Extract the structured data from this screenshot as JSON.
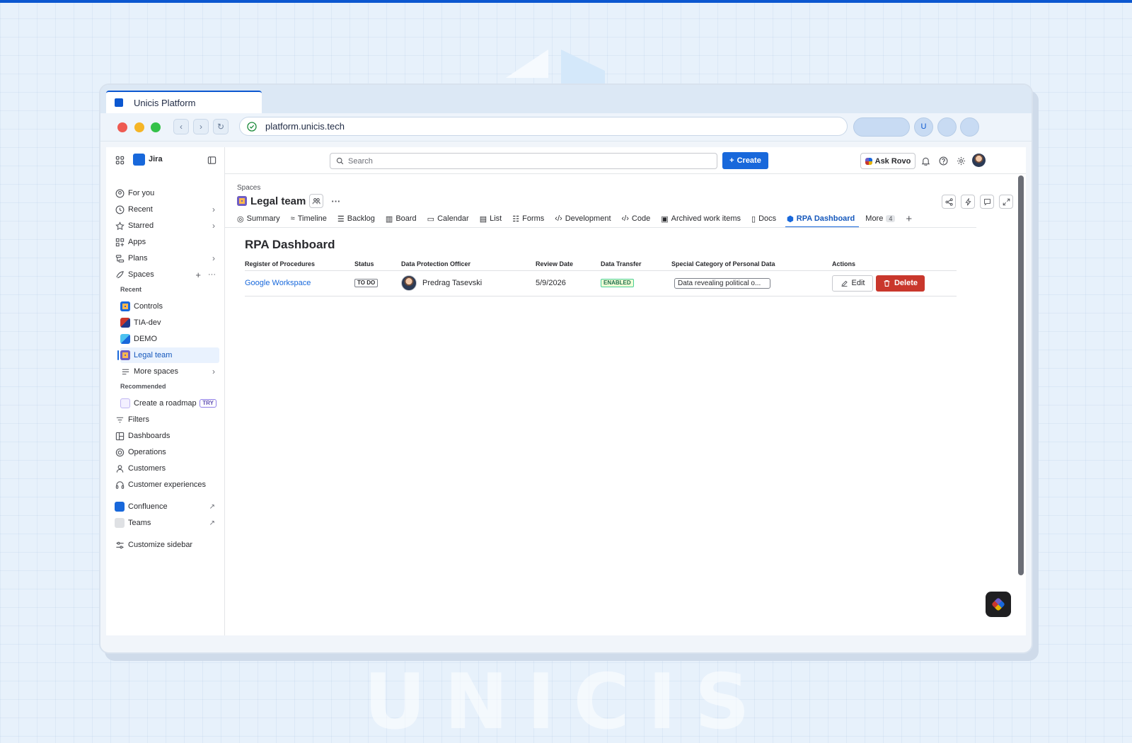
{
  "browser": {
    "tab_title": "Unicis Platform",
    "url": "platform.unicis.tech",
    "profile_initial": "U"
  },
  "sidebar": {
    "app_name": "Jira",
    "items": [
      {
        "label": "For you",
        "icon": "user-circle-icon"
      },
      {
        "label": "Recent",
        "icon": "clock-icon"
      },
      {
        "label": "Starred",
        "icon": "star-icon"
      },
      {
        "label": "Apps",
        "icon": "apps-icon"
      },
      {
        "label": "Plans",
        "icon": "plans-icon"
      },
      {
        "label": "Spaces",
        "icon": "spaces-icon"
      }
    ],
    "recent_heading": "Recent",
    "recent_spaces": [
      "Controls",
      "TIA-dev",
      "DEMO",
      "Legal team"
    ],
    "more_spaces": "More spaces",
    "recommended_heading": "Recommended",
    "recommended_item": "Create a roadmap",
    "try_badge": "TRY",
    "bottom_items": [
      "Filters",
      "Dashboards",
      "Operations",
      "Customers",
      "Customer experiences"
    ],
    "apps": [
      "Confluence",
      "Teams"
    ],
    "customize": "Customize sidebar"
  },
  "topbar": {
    "search_placeholder": "Search",
    "create_label": "Create",
    "ask_rovo": "Ask Rovo"
  },
  "page": {
    "breadcrumb": "Spaces",
    "title": "Legal team",
    "tabs": [
      "Summary",
      "Timeline",
      "Backlog",
      "Board",
      "Calendar",
      "List",
      "Forms",
      "Development",
      "Code",
      "Archived work items",
      "Docs",
      "RPA Dashboard",
      "More"
    ],
    "active_tab": "RPA Dashboard",
    "more_count": "4"
  },
  "dashboard": {
    "heading": "RPA Dashboard",
    "columns": [
      "Register of Procedures",
      "Status",
      "Data Protection Officer",
      "Review Date",
      "Data Transfer",
      "Special Category of Personal Data",
      "Actions"
    ],
    "rows": [
      {
        "procedure": "Google Workspace",
        "status": "TO DO",
        "officer": "Predrag Tasevski",
        "review_date": "5/9/2026",
        "transfer": "ENABLED",
        "special_category": "Data revealing political o...",
        "edit": "Edit",
        "delete": "Delete"
      }
    ]
  },
  "background": {
    "watermark": "UNICIS"
  },
  "colors": {
    "accent": "#1868db",
    "danger": "#c9372c",
    "success": "#216e4e",
    "browser_accent": "#0b57d0"
  }
}
